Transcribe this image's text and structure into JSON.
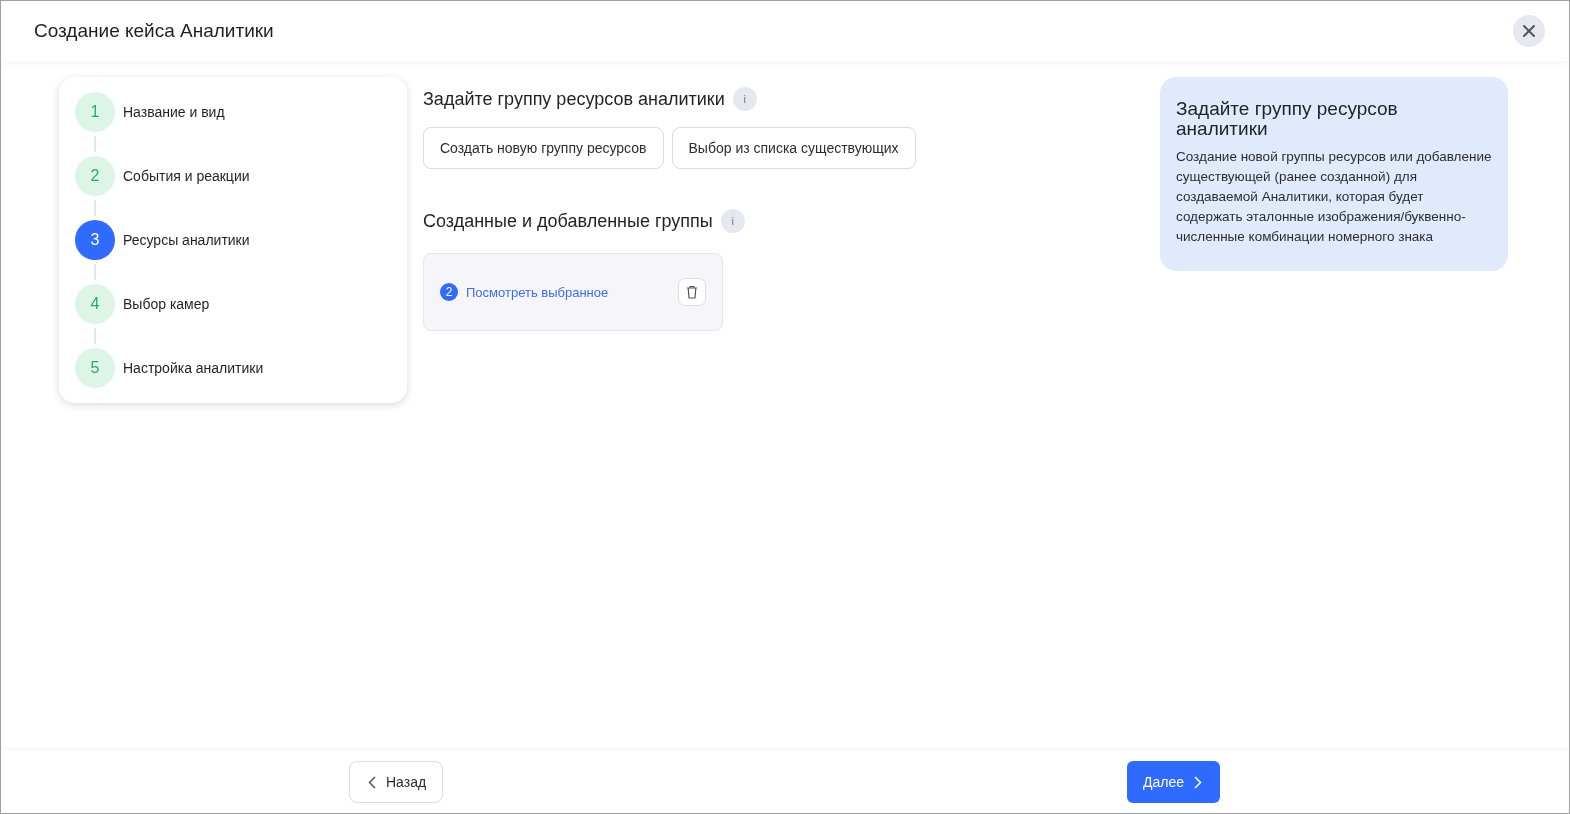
{
  "window": {
    "title": "Создание кейса Аналитики"
  },
  "steps": [
    {
      "number": "1",
      "label": "Название и вид",
      "selected": false
    },
    {
      "number": "2",
      "label": "События и реакции",
      "selected": false
    },
    {
      "number": "3",
      "label": "Ресурсы аналитики",
      "selected": true
    },
    {
      "number": "4",
      "label": "Выбор камер",
      "selected": false
    },
    {
      "number": "5",
      "label": "Настройка аналитики",
      "selected": false
    }
  ],
  "resource_group": {
    "heading": "Задайте группу ресурсов аналитики",
    "info": "i",
    "buttons": [
      "Создать новую группу ресурсов",
      "Выбор из списка существующих"
    ]
  },
  "added_groups": {
    "heading": "Созданные и добавленные группы",
    "info": "i",
    "groups": [
      {
        "count": "2",
        "link": "Посмотреть выбранное"
      }
    ]
  },
  "help": {
    "title": "Задайте группу ресурсов аналитики",
    "text": "Создание новой группы ресурсов или добавление существующей (ранее созданной) для создаваемой Аналитики, которая будет содержать эталонные изображения/буквенно-численные комбинации номерного знака"
  },
  "footer": {
    "back": "Назад",
    "next": "Далее"
  }
}
